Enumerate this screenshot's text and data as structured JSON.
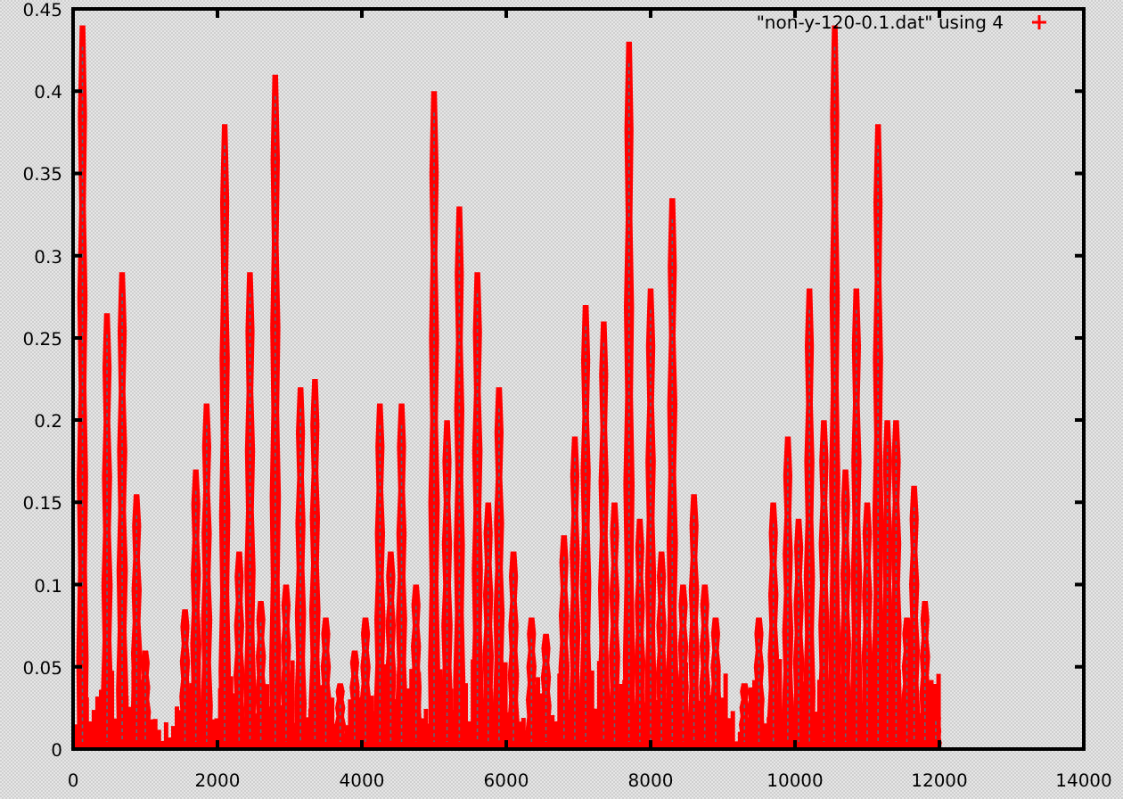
{
  "plot": {
    "legend": {
      "label": "\"non-y-120-0.1.dat\" using 4"
    },
    "y_axis": {
      "ticks": [
        "0.45",
        "0.4",
        "0.35",
        "0.3",
        "0.25",
        "0.2",
        "0.15",
        "0.1",
        "0.05",
        "0"
      ]
    },
    "x_axis": {
      "ticks": [
        "0",
        "2000",
        "4000",
        "6000",
        "8000",
        "10000",
        "12000",
        "14000"
      ]
    }
  }
}
